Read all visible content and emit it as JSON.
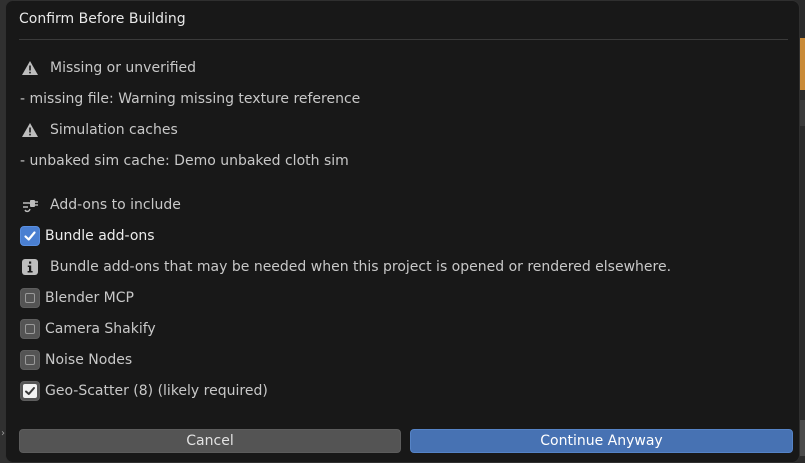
{
  "dialog": {
    "title": "Confirm Before Building"
  },
  "sections": {
    "missing": {
      "heading": "Missing or unverified",
      "item": "- missing file: Warning missing texture reference"
    },
    "caches": {
      "heading": "Simulation caches",
      "item": "- unbaked sim cache: Demo unbaked cloth sim"
    },
    "addons": {
      "heading": "Add-ons to include",
      "bundle_label": "Bundle add-ons",
      "bundle_checked": true,
      "info": "Bundle add-ons that may be needed when this project is opened or rendered elsewhere.",
      "items": [
        {
          "label": "Blender MCP",
          "checked": false
        },
        {
          "label": "Camera Shakify",
          "checked": false
        },
        {
          "label": "Noise Nodes",
          "checked": false
        },
        {
          "label": "Geo-Scatter (8) (likely required)",
          "checked": true
        }
      ]
    }
  },
  "buttons": {
    "cancel": "Cancel",
    "continue": "Continue Anyway"
  },
  "colors": {
    "accent": "#4772b3",
    "checkbox_blue": "#4a7fd1",
    "dialog_bg": "#181818"
  },
  "icons": {
    "warning": "warning-icon",
    "plugin": "plugin-icon",
    "info": "info-icon",
    "check": "check-icon"
  }
}
